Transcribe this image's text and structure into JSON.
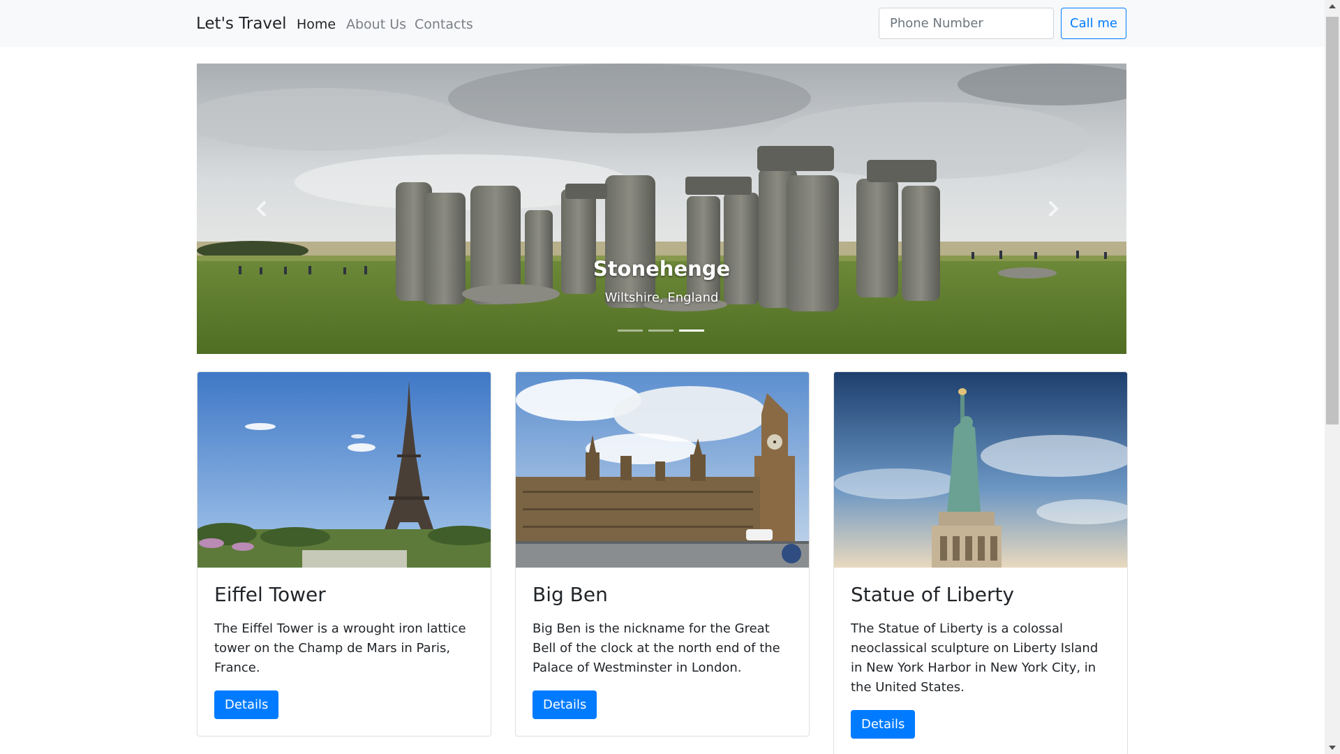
{
  "navbar": {
    "brand": "Let's Travel",
    "links": [
      {
        "label": "Home",
        "active": true
      },
      {
        "label": "About Us",
        "active": false
      },
      {
        "label": "Contacts",
        "active": false
      }
    ],
    "phone_placeholder": "Phone Number",
    "call_label": "Call me"
  },
  "carousel": {
    "title": "Stonehenge",
    "subtitle": "Wiltshire, England",
    "slide_count": 3,
    "active_slide": 3
  },
  "cards": [
    {
      "title": "Eiffel Tower",
      "text": "The Eiffel Tower is a wrought iron lattice tower on the Champ de Mars in Paris, France.",
      "button": "Details"
    },
    {
      "title": "Big Ben",
      "text": "Big Ben is the nickname for the Great Bell of the clock at the north end of the Palace of Westminster in London.",
      "button": "Details"
    },
    {
      "title": "Statue of Liberty",
      "text": "The Statue of Liberty is a colossal neoclassical sculpture on Liberty Island in New York Harbor in New York City, in the United States.",
      "button": "Details"
    }
  ],
  "colors": {
    "primary": "#007bff",
    "navbar_bg": "#f8f9fa",
    "text": "#212529",
    "muted_link": "#7a7f85"
  }
}
